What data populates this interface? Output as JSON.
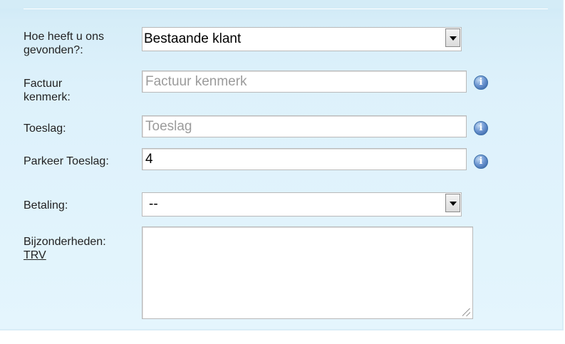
{
  "form": {
    "gevonden": {
      "label": "Hoe heeft u ons gevonden?:",
      "value": "Bestaande klant"
    },
    "factuur_kenmerk": {
      "label": "Factuur kenmerk:",
      "value": "",
      "placeholder": "Factuur kenmerk"
    },
    "toeslag": {
      "label": "Toeslag:",
      "value": "",
      "placeholder": "Toeslag"
    },
    "parkeer_toeslag": {
      "label": "Parkeer Toeslag:",
      "value": "4"
    },
    "betaling": {
      "label": "Betaling:",
      "value": "--"
    },
    "bijzonderheden": {
      "label": "Bijzonderheden:",
      "link": "TRV",
      "value": ""
    }
  },
  "icons": {
    "info": "info-icon",
    "dropdown": "chevron-down-icon",
    "resize": "resize-grip-icon"
  },
  "colors": {
    "panel_background": "#ddf1fb",
    "info_icon": "#3a6ea8",
    "placeholder_text": "#9b9b9b"
  }
}
